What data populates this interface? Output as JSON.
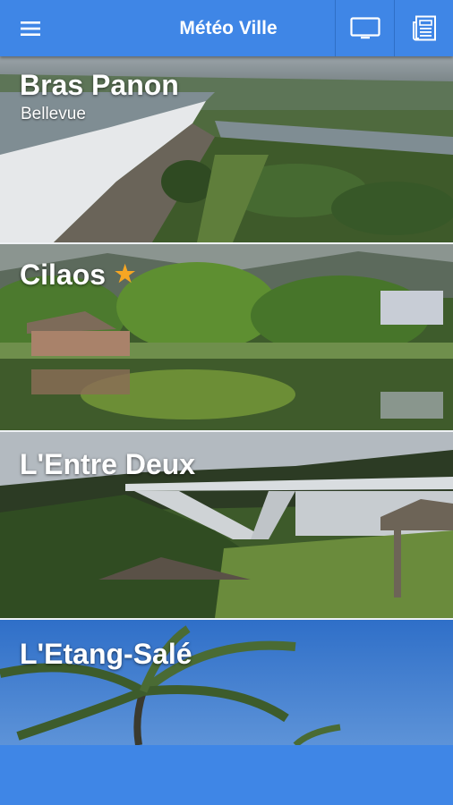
{
  "app": {
    "title": "Météo Ville"
  },
  "toolbar": {
    "menu_icon": "hamburger-menu-icon",
    "tv_icon": "tv-icon",
    "news_icon": "newspaper-icon"
  },
  "colors": {
    "primary": "#3f86e6",
    "star": "#f6a623"
  },
  "cities": [
    {
      "name": "Bras Panon",
      "subtitle": "Bellevue",
      "favorite": false
    },
    {
      "name": "Cilaos",
      "subtitle": "",
      "favorite": true
    },
    {
      "name": "L'Entre Deux",
      "subtitle": "",
      "favorite": false
    },
    {
      "name": "L'Etang-Salé",
      "subtitle": "",
      "favorite": false
    }
  ]
}
